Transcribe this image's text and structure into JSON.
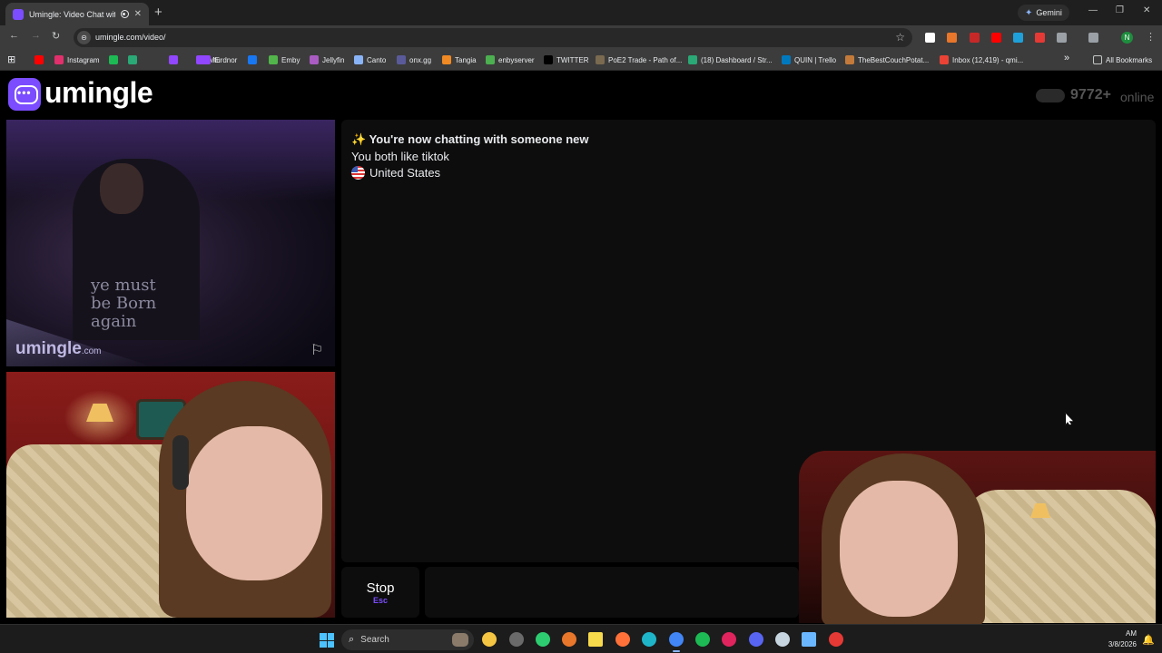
{
  "browser": {
    "tab_title": "Umingle: Video Chat with S",
    "tab_close": "✕",
    "new_tab": "+",
    "gemini_label": "Gemini",
    "gemini_icon": "✦",
    "window_controls": {
      "minimize": "—",
      "maximize": "❐",
      "close": "✕"
    },
    "nav": {
      "back": "←",
      "forward": "→",
      "reload": "↻"
    },
    "site_info_icon": "⊝",
    "url": "umingle.com/video/",
    "star": "☆",
    "profile_initial": "N",
    "menu": "⋮",
    "apps_icon": "⊞",
    "bookmarks": [
      {
        "label": "",
        "color": "#ff0000"
      },
      {
        "label": "Instagram",
        "color": "#e1306c"
      },
      {
        "label": "",
        "color": "#1db954"
      },
      {
        "label": "",
        "color": "#2aa876"
      },
      {
        "label": "",
        "color": "#9146ff"
      },
      {
        "label": "ME",
        "color": "#9146ff"
      },
      {
        "label": "turdnor",
        "color": "#9146ff"
      },
      {
        "label": "",
        "color": "#1877f2"
      },
      {
        "label": "Emby",
        "color": "#52b54b"
      },
      {
        "label": "Jellyfin",
        "color": "#aa5cc3"
      },
      {
        "label": "Canto",
        "color": "#8ab4f8"
      },
      {
        "label": "onx.gg",
        "color": "#5a5a9a"
      },
      {
        "label": "Tangia",
        "color": "#f08a24"
      },
      {
        "label": "enbyserver",
        "color": "#4caf50"
      },
      {
        "label": "TWITTER",
        "color": "#000000"
      },
      {
        "label": "PoE2 Trade - Path of...",
        "color": "#7a6a50"
      },
      {
        "label": "(18) Dashboard / Str...",
        "color": "#2aa876"
      },
      {
        "label": "QUIN | Trello",
        "color": "#0079bf"
      },
      {
        "label": "TheBestCouchPotat...",
        "color": "#c47a3a"
      },
      {
        "label": "Inbox (12,419) - qmi...",
        "color": "#ea4335"
      }
    ],
    "bookmarks_overflow": "»",
    "all_bookmarks": "All Bookmarks"
  },
  "page": {
    "logo_text": "umingle",
    "online_count": "9772+",
    "online_label": "online",
    "watermark_text": "umingle",
    "watermark_suffix": ".com",
    "report_icon": "⚐",
    "shirt_text": "ye must\nbe Born\nagain",
    "chat": {
      "line1": "✨ You're now chatting with someone new",
      "line2": "You both like tiktok",
      "country": "United States"
    },
    "stop_label": "Stop",
    "stop_key": "Esc",
    "message_placeholder": ""
  },
  "taskbar": {
    "search_label": "Search",
    "search_icon": "⌕",
    "time": "AM",
    "date": "3/8/2026",
    "notification_icon": "🔔",
    "apps": [
      {
        "name": "file-explorer-icon",
        "color": "#f4c542"
      },
      {
        "name": "app-circle-icon",
        "color": "#6a6a6a"
      },
      {
        "name": "play-icon",
        "color": "#2ecc71"
      },
      {
        "name": "orange-app-icon",
        "color": "#e8762b"
      },
      {
        "name": "sticky-notes-icon",
        "color": "#f7d94c"
      },
      {
        "name": "firefox-icon",
        "color": "#ff7139"
      },
      {
        "name": "edge-icon",
        "color": "#1fb5c9"
      },
      {
        "name": "chrome-icon",
        "color": "#4285f4"
      },
      {
        "name": "spotify-icon",
        "color": "#1db954"
      },
      {
        "name": "red-app-icon",
        "color": "#e0245e"
      },
      {
        "name": "discord-icon",
        "color": "#5865f2"
      },
      {
        "name": "steam-icon",
        "color": "#c7d5e0"
      },
      {
        "name": "notepad-icon",
        "color": "#6ab7ff"
      },
      {
        "name": "red-circle-app-icon",
        "color": "#e53935"
      }
    ]
  },
  "colors": {
    "accent": "#7b4dff",
    "panel": "#0d0d0d"
  }
}
